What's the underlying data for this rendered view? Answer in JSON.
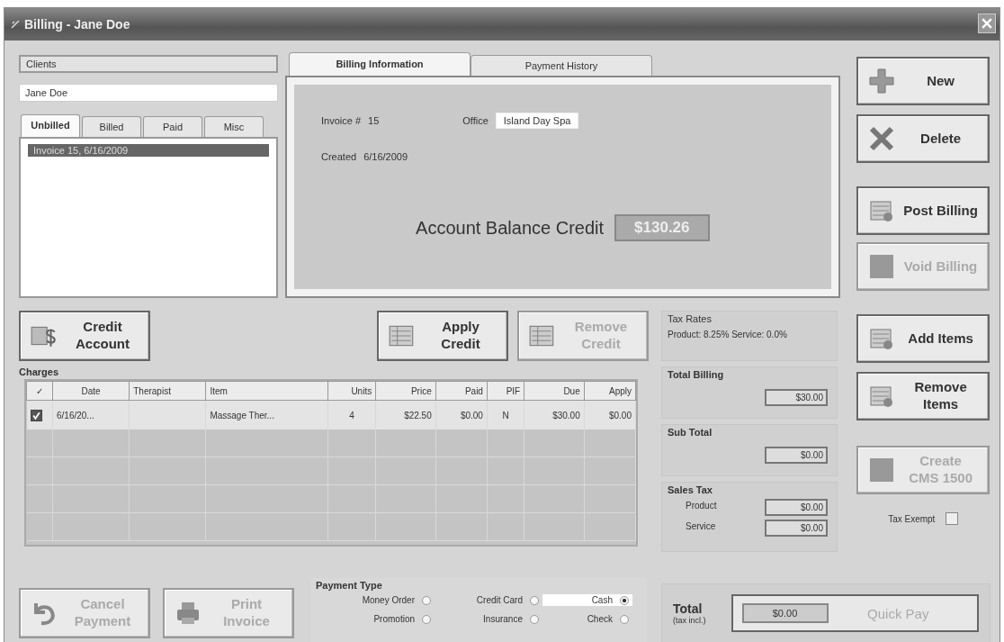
{
  "window": {
    "title": "Billing - Jane Doe"
  },
  "client": {
    "label": "Clients",
    "value": "Jane Doe"
  },
  "invoice_tabs": [
    {
      "label": "Unbilled",
      "selected": true
    },
    {
      "label": "Billed",
      "selected": false
    },
    {
      "label": "Paid",
      "selected": false
    },
    {
      "label": "Misc",
      "selected": false
    }
  ],
  "invoices": [
    {
      "label": "Invoice 15, 6/16/2009",
      "selected": true
    }
  ],
  "billing_tabs": [
    {
      "label": "Billing Information",
      "selected": true
    },
    {
      "label": "Payment History",
      "selected": false
    }
  ],
  "billing_info": {
    "invoice_label": "Invoice #",
    "invoice": "15",
    "office_label": "Office",
    "office": "Island Day Spa",
    "created_label": "Created",
    "created": "6/16/2009",
    "balance_label": "Account Balance Credit",
    "balance": "$130.26"
  },
  "side_buttons": [
    {
      "kind": "new",
      "label": "New",
      "disabled": false
    },
    {
      "kind": "delete",
      "label": "Delete",
      "disabled": false
    },
    {
      "kind": "post",
      "label": "Post Billing",
      "disabled": false
    },
    {
      "kind": "void",
      "label": "Void Billing",
      "disabled": true
    },
    {
      "kind": "add",
      "label": "Add Items",
      "disabled": false
    },
    {
      "kind": "remove",
      "label": "Remove Items",
      "disabled": false
    },
    {
      "kind": "form",
      "label": "Create CMS 1500",
      "disabled": true
    }
  ],
  "credit_buttons": [
    {
      "kind": "credit",
      "label": "Credit Account",
      "disabled": false
    },
    {
      "kind": "apply",
      "label": "Apply Credit",
      "disabled": false
    },
    {
      "kind": "uncredit",
      "label": "Remove Credit",
      "disabled": true
    }
  ],
  "tax_rates": {
    "title": "Tax Rates",
    "text": "Product: 8.25%  Service: 0.0%"
  },
  "charges": {
    "title": "Charges",
    "columns": [
      "✓",
      "Date",
      "Therapist",
      "Item",
      "Units",
      "Price",
      "Paid",
      "PIF",
      "Due",
      "Apply"
    ],
    "rows": [
      {
        "checked": true,
        "date": "6/16/20...",
        "item": "Massage Ther...",
        "units": "4",
        "price": "$22.50",
        "paid": "$0.00",
        "pif": "N",
        "due": "$30.00",
        "apply": "$0.00"
      }
    ]
  },
  "total_billing": {
    "title": "Total Billing",
    "value": "$30.00"
  },
  "sub_total": {
    "title": "Sub Total",
    "value": "$0.00"
  },
  "sales_tax": {
    "title": "Sales Tax",
    "product_label": "Product",
    "product": "$0.00",
    "service_label": "Service",
    "service": "$0.00"
  },
  "tax_exempt": {
    "label": "Tax Exempt",
    "checked": false
  },
  "bottom_buttons": [
    {
      "kind": "cancel",
      "label": "Cancel Payment",
      "disabled": true
    },
    {
      "kind": "print",
      "label": "Print Invoice",
      "disabled": true
    }
  ],
  "payment_type": {
    "title": "Payment Type",
    "options": [
      {
        "label": "Money Order",
        "selected": false
      },
      {
        "label": "Credit Card",
        "selected": false
      },
      {
        "label": "Cash",
        "selected": true
      },
      {
        "label": "Promotion",
        "selected": false
      },
      {
        "label": "Insurance",
        "selected": false
      },
      {
        "label": "Check",
        "selected": false
      }
    ]
  },
  "total": {
    "label": "Total",
    "sublabel": "(tax incl.)",
    "value": "$0.00",
    "quick_pay": {
      "label": "Quick Pay",
      "disabled": true
    }
  }
}
